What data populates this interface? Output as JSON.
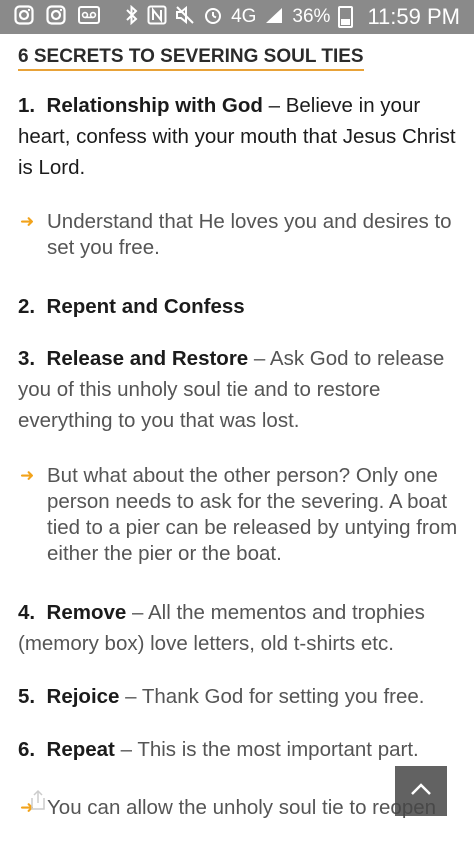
{
  "status_bar": {
    "left_icons": [
      "instagram-icon",
      "instagram-icon",
      "voicemail-icon"
    ],
    "right_icons": [
      "bluetooth-icon",
      "nfc-icon",
      "mute-icon",
      "alarm-icon"
    ],
    "network": "4G",
    "battery": "36%",
    "time": "11:59 PM"
  },
  "article": {
    "title": "6 SECRETS TO SEVERING SOUL TIES",
    "items": [
      {
        "num": "1.",
        "label": "Relationship with God",
        "dash": "–",
        "desc": "Believe in your heart, confess with your mouth that Jesus Christ is Lord."
      },
      {
        "num": "2.",
        "label": "Repent and Confess",
        "dash": "",
        "desc": ""
      },
      {
        "num": "3.",
        "label": "Release and Restore",
        "dash": "–",
        "desc": "Ask God to release you of this unholy soul tie and to restore everything to you that was lost."
      },
      {
        "num": "4.",
        "label": "Remove",
        "dash": "–",
        "desc": "All the mementos and trophies (memory box) love letters, old t-shirts etc."
      },
      {
        "num": "5.",
        "label": "Rejoice",
        "dash": "–",
        "desc": "Thank God for setting you free."
      },
      {
        "num": "6.",
        "label": "Repeat",
        "dash": "–",
        "desc": "This is the most important part."
      }
    ],
    "bullets": [
      "Understand that He loves you and desires to set you free.",
      "But what about the other person?  Only one person needs to ask for the severing. A boat tied to a pier can be released by untying from either the pier or the boat.",
      "You can allow the unholy soul tie to reopen"
    ]
  },
  "controls": {
    "scroll_top_icon": "chevron-up-icon",
    "share_icon": "share-icon"
  }
}
